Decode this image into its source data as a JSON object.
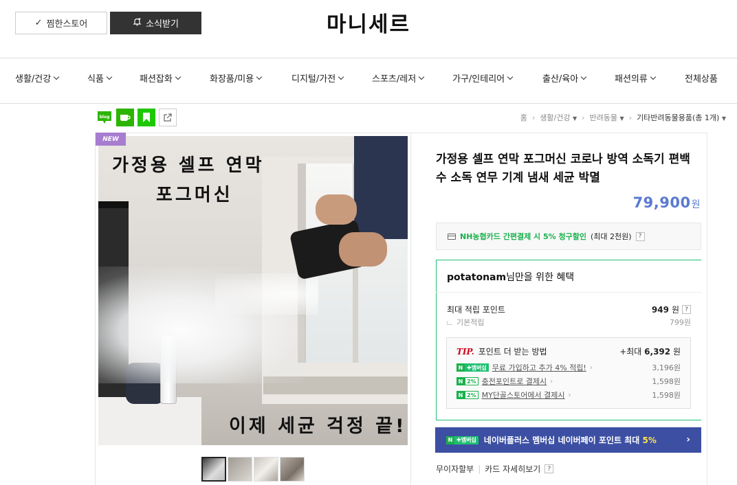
{
  "header": {
    "wish_label": "찜한스토어",
    "news_label": "소식받기",
    "store_name": "마니세르"
  },
  "nav": {
    "items": [
      "생활/건강",
      "식품",
      "패션잡화",
      "화장품/미용",
      "디지털/가전",
      "스포츠/레저",
      "가구/인테리어",
      "출산/육아",
      "패션의류",
      "전체상품"
    ]
  },
  "share": {
    "blog_label": "blog"
  },
  "breadcrumb": {
    "home": "홈",
    "level1": "생활/건강",
    "level2": "반려동물",
    "level3": "기타반려동물용품(총 1개)"
  },
  "product": {
    "badge": "NEW",
    "image_text_1": "가정용 셀프 연막",
    "image_text_2": "포그머신",
    "image_text_3": "이제 세균 걱정 끝!!",
    "title": "가정용 셀프 연막 포그머신 코로나 방역 소독기 편백수 소독 연무 기계 냄새 세균 박멸",
    "price": "79,900",
    "price_unit": "원"
  },
  "card_promo": {
    "highlight": "NH농협카드 간편결제 시 5% 청구할인",
    "detail": "(최대 2천원)",
    "help": "?"
  },
  "benefit": {
    "user": "potatonam",
    "head_suffix": "님만을 위한 혜택",
    "max_label": "최대 적립 포인트",
    "max_value": "949",
    "max_unit": "원",
    "help": "?",
    "base_label": "기본적립",
    "base_value": "799원",
    "tip_prefix": "TIP.",
    "tip_label": "포인트 더 받는 방법",
    "tip_max": "+최대",
    "tip_max_value": "6,392",
    "tip_max_unit": "원",
    "tips": [
      {
        "badge_right": "멤버십",
        "text": "무료 가입하고 추가 4% 적립!",
        "value": "3,196원"
      },
      {
        "badge_right": "2%",
        "text": "충전포인트로 결제시",
        "value": "1,598원"
      },
      {
        "badge_right": "2%",
        "text": "MY단골스토어에서 결제시",
        "value": "1,598원"
      }
    ]
  },
  "plus_bar": {
    "badge": "멤버십",
    "text": "네이버플러스 멤버십 네이버페이 포인트 최대",
    "highlight": "5%"
  },
  "install": {
    "label": "무이자할부",
    "card_link": "카드 자세히보기",
    "help": "?"
  },
  "colors": {
    "price": "#5a7ad0",
    "naver_green": "#19b14b",
    "plus_bar": "#3c4fa3",
    "new_badge": "#a77dd0"
  }
}
